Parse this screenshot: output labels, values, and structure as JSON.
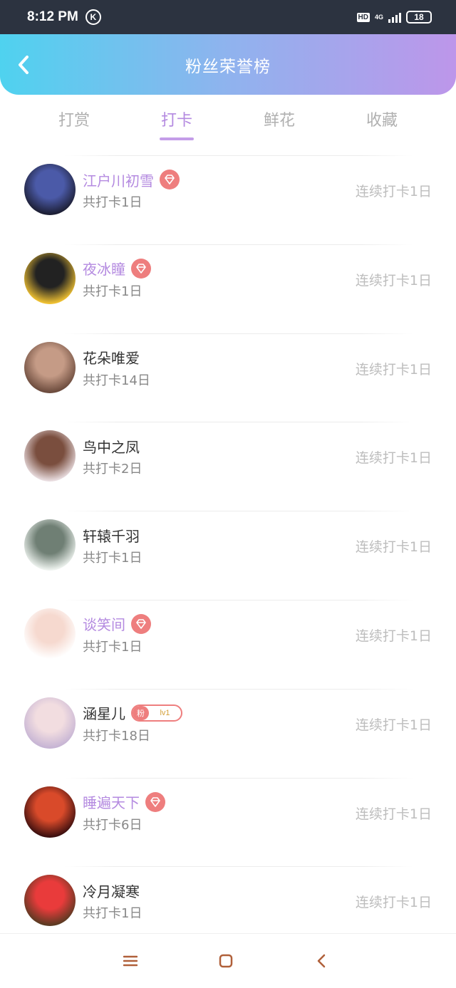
{
  "status_bar": {
    "time": "8:12 PM",
    "carrier_icon": "K",
    "hd": "HD",
    "network": "4G",
    "battery": "18"
  },
  "header": {
    "title": "粉丝荣誉榜"
  },
  "tabs": [
    {
      "label": "打赏",
      "active": false
    },
    {
      "label": "打卡",
      "active": true
    },
    {
      "label": "鲜花",
      "active": false
    },
    {
      "label": "收藏",
      "active": false
    }
  ],
  "fans": [
    {
      "name": "江户川初雪",
      "vip": true,
      "badge": "gem",
      "total": "共打卡1日",
      "streak": "连续打卡1日",
      "avatar_colors": [
        "#1c1e33",
        "#4b5aa8"
      ]
    },
    {
      "name": "夜冰瞳",
      "vip": true,
      "badge": "gem",
      "total": "共打卡1日",
      "streak": "连续打卡1日",
      "avatar_colors": [
        "#f1c232",
        "#222222"
      ]
    },
    {
      "name": "花朵唯爱",
      "vip": false,
      "badge": "",
      "total": "共打卡14日",
      "streak": "连续打卡1日",
      "avatar_colors": [
        "#6b4a3c",
        "#c59b86"
      ]
    },
    {
      "name": "鸟中之凤",
      "vip": false,
      "badge": "",
      "total": "共打卡2日",
      "streak": "连续打卡1日",
      "avatar_colors": [
        "#e9dde0",
        "#7a4e3e"
      ]
    },
    {
      "name": "轩辕千羽",
      "vip": false,
      "badge": "",
      "total": "共打卡1日",
      "streak": "连续打卡1日",
      "avatar_colors": [
        "#eef3ef",
        "#6f7f74"
      ]
    },
    {
      "name": "谈笑间",
      "vip": true,
      "badge": "gem",
      "total": "共打卡1日",
      "streak": "连续打卡1日",
      "avatar_colors": [
        "#ffffff",
        "#f6d9cf"
      ]
    },
    {
      "name": "涵星儿",
      "vip": false,
      "badge": "fan",
      "badge_fan": "粉",
      "badge_level": "lv1",
      "total": "共打卡18日",
      "streak": "连续打卡1日",
      "avatar_colors": [
        "#c6b4d4",
        "#f2dde0"
      ]
    },
    {
      "name": "睡遍天下",
      "vip": true,
      "badge": "gem",
      "total": "共打卡6日",
      "streak": "连续打卡1日",
      "avatar_colors": [
        "#3b0f0f",
        "#d94a2a"
      ]
    },
    {
      "name": "冷月凝寒",
      "vip": false,
      "badge": "",
      "total": "共打卡1日",
      "streak": "连续打卡1日",
      "avatar_colors": [
        "#5a3a22",
        "#e93b3b"
      ]
    }
  ],
  "nav": {
    "menu_icon": "menu-icon",
    "home_icon": "home-icon",
    "back_icon": "back-icon"
  },
  "colors": {
    "accent": "#b48ae0",
    "badge": "#ee7e7e",
    "header_start": "#4fd2ef",
    "header_end": "#bd96ea"
  }
}
